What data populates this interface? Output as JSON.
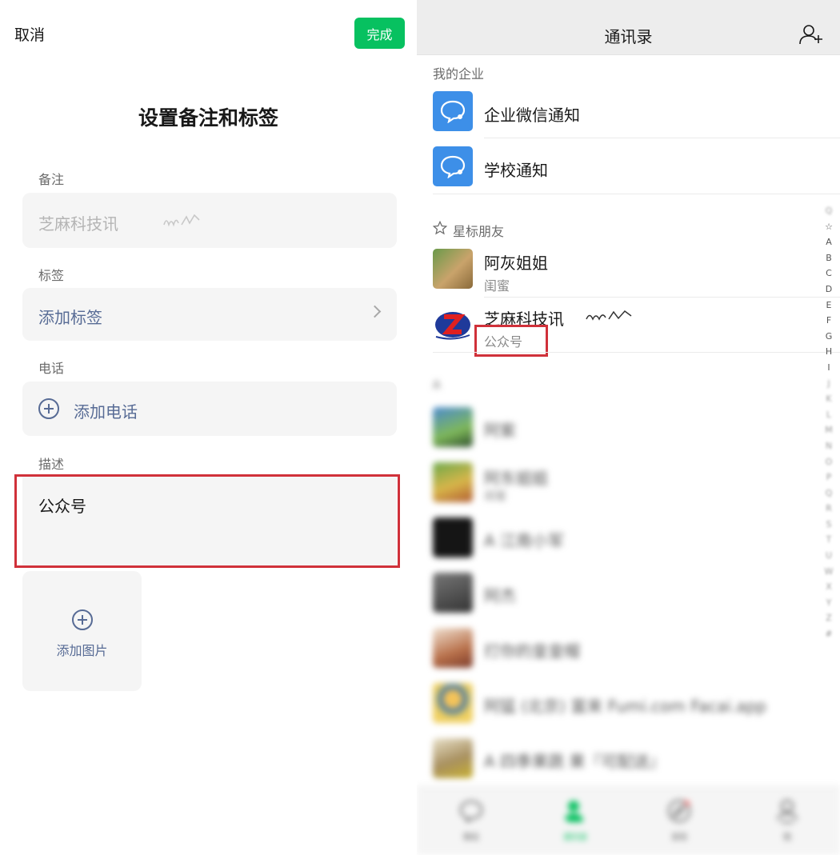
{
  "left": {
    "cancel_label": "取消",
    "done_label": "完成",
    "title": "设置备注和标签",
    "remark": {
      "label": "备注",
      "value": "芝麻科技讯"
    },
    "tags": {
      "label": "标签",
      "action": "添加标签"
    },
    "phone": {
      "label": "电话",
      "action": "添加电话"
    },
    "description": {
      "label": "描述",
      "value": "公众号"
    },
    "add_image_label": "添加图片"
  },
  "right": {
    "title": "通讯录",
    "enterprise_section": "我的企业",
    "enterprise_items": [
      {
        "name": "企业微信通知"
      },
      {
        "name": "学校通知"
      }
    ],
    "starred_section": "星标朋友",
    "starred": [
      {
        "name": "阿灰姐姐",
        "sub": "闺蜜"
      },
      {
        "name": "芝麻科技讯",
        "sub": "公众号"
      }
    ],
    "group_letter": "A",
    "contacts": [
      {
        "name": "阿紫",
        "sub": ""
      },
      {
        "name": "阿东姐姐",
        "sub": "闺蜜"
      },
      {
        "name": "A 江南小军",
        "sub": ""
      },
      {
        "name": "阿杰",
        "sub": ""
      },
      {
        "name": "打你的皇皇帽",
        "sub": ""
      },
      {
        "name": "阿猛 (北京) 富来 Fumi.com Facai.app",
        "sub": ""
      },
      {
        "name": "A 四季果蔬 果『可配送』",
        "sub": ""
      }
    ],
    "index_letters": [
      "Q",
      "☆",
      "A",
      "B",
      "C",
      "D",
      "E",
      "F",
      "G",
      "H",
      "I",
      "J",
      "K",
      "L",
      "M",
      "N",
      "O",
      "P",
      "Q",
      "R",
      "S",
      "T",
      "U",
      "W",
      "X",
      "Y",
      "Z",
      "#"
    ],
    "tabs": [
      {
        "label": "微信"
      },
      {
        "label": "通讯录"
      },
      {
        "label": "发现"
      },
      {
        "label": "我"
      }
    ],
    "colors": {
      "accent": "#07c160",
      "link": "#576b95",
      "highlight": "#d0313a",
      "enterprise_icon": "#3d8fe8"
    }
  }
}
